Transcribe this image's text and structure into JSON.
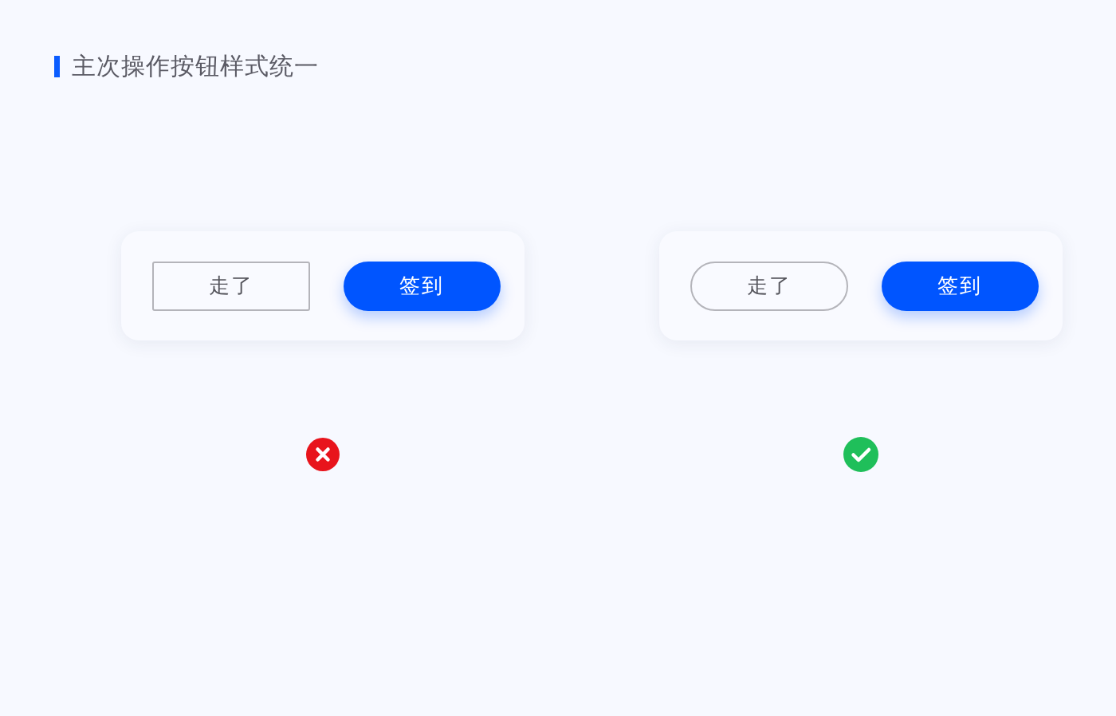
{
  "title": "主次操作按钮样式统一",
  "examples": [
    {
      "correct": false,
      "buttons": [
        {
          "label": "走了",
          "kind": "secondary",
          "rounded": false
        },
        {
          "label": "签到",
          "kind": "primary",
          "rounded": true
        }
      ]
    },
    {
      "correct": true,
      "buttons": [
        {
          "label": "走了",
          "kind": "secondary",
          "rounded": true
        },
        {
          "label": "签到",
          "kind": "primary",
          "rounded": true
        }
      ]
    }
  ]
}
